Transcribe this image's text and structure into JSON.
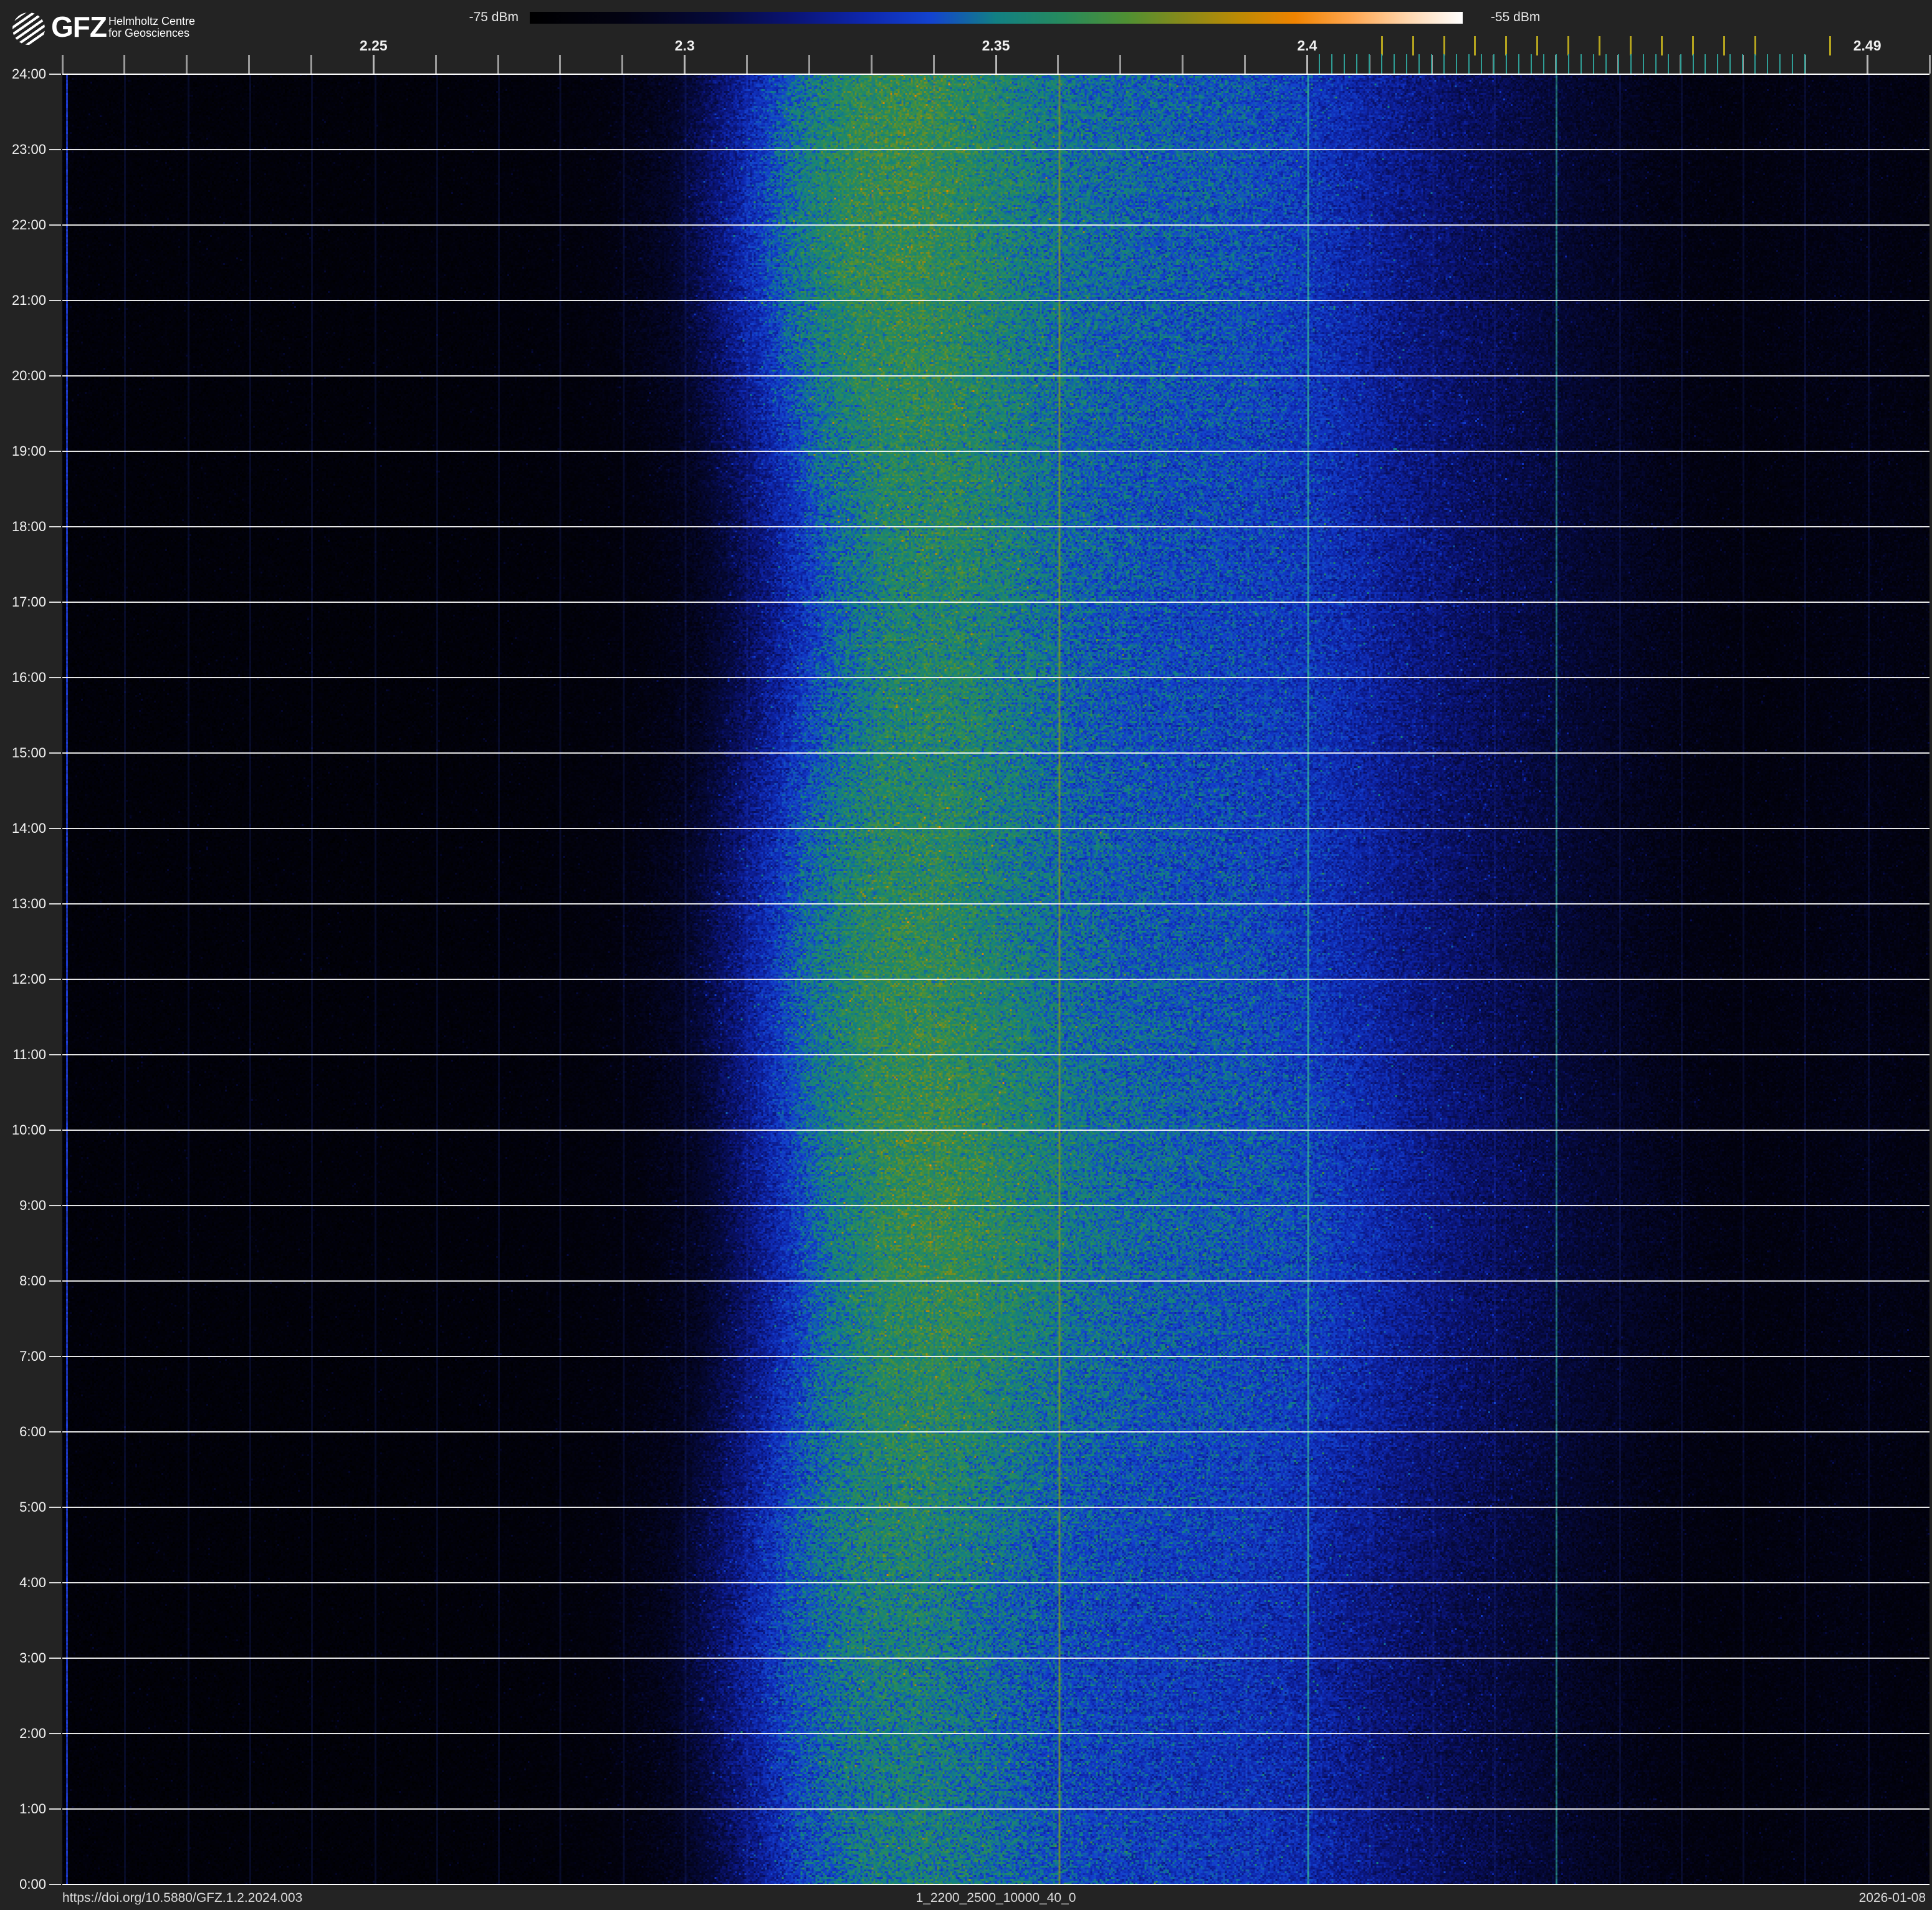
{
  "logo": {
    "org": "GFZ",
    "line1": "Helmholtz Centre",
    "line2": "for Geosciences"
  },
  "colorbar": {
    "min_label": "-75 dBm",
    "max_label": "-55 dBm",
    "min_dBm": -75,
    "max_dBm": -55,
    "stops": [
      {
        "u": 0.0,
        "hex": "#000000"
      },
      {
        "u": 0.1,
        "hex": "#020212"
      },
      {
        "u": 0.2,
        "hex": "#05093a"
      },
      {
        "u": 0.28,
        "hex": "#0a1372"
      },
      {
        "u": 0.36,
        "hex": "#0e27ae"
      },
      {
        "u": 0.43,
        "hex": "#1343cf"
      },
      {
        "u": 0.5,
        "hex": "#128083"
      },
      {
        "u": 0.57,
        "hex": "#268a5e"
      },
      {
        "u": 0.64,
        "hex": "#4f9033"
      },
      {
        "u": 0.7,
        "hex": "#888a1a"
      },
      {
        "u": 0.76,
        "hex": "#bc8a04"
      },
      {
        "u": 0.82,
        "hex": "#f08300"
      },
      {
        "u": 0.88,
        "hex": "#ffa64f"
      },
      {
        "u": 0.94,
        "hex": "#ffd6ad"
      },
      {
        "u": 1.0,
        "hex": "#ffffff"
      }
    ]
  },
  "axes": {
    "freq_GHz": {
      "min": 2.2,
      "max": 2.5,
      "minor_tick_step_GHz": 0.01,
      "labeled_ticks": [
        {
          "value": 2.25,
          "label": "2.25"
        },
        {
          "value": 2.3,
          "label": "2.3"
        },
        {
          "value": 2.35,
          "label": "2.35"
        },
        {
          "value": 2.4,
          "label": "2.4"
        },
        {
          "value": 2.49,
          "label": "2.49"
        }
      ]
    },
    "wifi_channel_ticks_MHz": [
      2412,
      2417,
      2422,
      2427,
      2432,
      2437,
      2442,
      2447,
      2452,
      2457,
      2462,
      2467,
      2472,
      2484
    ],
    "ble_channel_ticks_MHz": {
      "start": 2402,
      "end": 2480,
      "step": 2
    },
    "tick_colors": {
      "minor": "#9a9a9a",
      "labeled": "#b8b8b8",
      "wifi": "#b5a41e",
      "ble": "#2f9e96"
    },
    "time": {
      "hour_labels": [
        "24:00",
        "23:00",
        "22:00",
        "21:00",
        "20:00",
        "19:00",
        "18:00",
        "17:00",
        "16:00",
        "15:00",
        "14:00",
        "13:00",
        "12:00",
        "11:00",
        "10:00",
        "9:00",
        "8:00",
        "7:00",
        "6:00",
        "5:00",
        "4:00",
        "3:00",
        "2:00",
        "1:00",
        "0:00"
      ]
    }
  },
  "footer": {
    "doi": "https://doi.org/10.5880/GFZ.1.2.2024.003",
    "title": "1_2200_2500_10000_40_0",
    "date": "2026-01-08"
  },
  "chart_data": {
    "type": "heatmap",
    "title": "1_2200_2500_10000_40_0",
    "x_axis": {
      "label_unit": "GHz",
      "range": [
        2.2,
        2.5
      ],
      "labeled_ticks": [
        2.25,
        2.3,
        2.35,
        2.4,
        2.49
      ]
    },
    "y_axis": {
      "label_unit": "time of day",
      "range_hours": [
        0,
        24
      ],
      "top": "24:00",
      "bottom": "0:00"
    },
    "color_axis": {
      "label_unit": "dBm",
      "range": [
        -75,
        -55
      ]
    },
    "date": "2026-01-08",
    "spectral_profile": {
      "freq_MHz": [
        2200,
        2210,
        2220,
        2230,
        2240,
        2250,
        2260,
        2270,
        2280,
        2290,
        2300,
        2310,
        2320,
        2330,
        2340,
        2350,
        2360,
        2370,
        2380,
        2390,
        2400,
        2410,
        2420,
        2430,
        2440,
        2450,
        2460,
        2470,
        2480,
        2490,
        2500
      ],
      "level": [
        0.05,
        0.05,
        0.05,
        0.05,
        0.05,
        0.05,
        0.052,
        0.055,
        0.06,
        0.08,
        0.14,
        0.3,
        0.46,
        0.545,
        0.56,
        0.52,
        0.47,
        0.445,
        0.43,
        0.42,
        0.39,
        0.33,
        0.275,
        0.23,
        0.185,
        0.14,
        0.1,
        0.08,
        0.09,
        0.1,
        0.08
      ],
      "mean_power_dBm": [
        -74.0,
        -74.0,
        -74.0,
        -74.0,
        -74.0,
        -74.0,
        -74.0,
        -73.9,
        -73.8,
        -73.4,
        -72.2,
        -69.0,
        -65.8,
        -64.1,
        -63.8,
        -64.6,
        -65.6,
        -66.1,
        -66.4,
        -66.6,
        -67.2,
        -68.4,
        -69.5,
        -70.4,
        -71.3,
        -72.2,
        -73.0,
        -73.4,
        -73.2,
        -73.0,
        -73.4
      ]
    },
    "carriers": [
      {
        "freq_MHz": 2200.5,
        "color": "#2244ee",
        "alpha": 0.8
      },
      {
        "freq_MHz": 2360,
        "color": "#7d9223",
        "alpha": 0.85
      },
      {
        "freq_MHz": 2400,
        "color": "#2fa39a",
        "alpha": 0.9
      },
      {
        "freq_MHz": 2440,
        "color": "#2a9a90",
        "alpha": 0.75
      }
    ],
    "grid": {
      "hour_lines": true,
      "minor_freq_lines_MHz_step": 10
    }
  }
}
